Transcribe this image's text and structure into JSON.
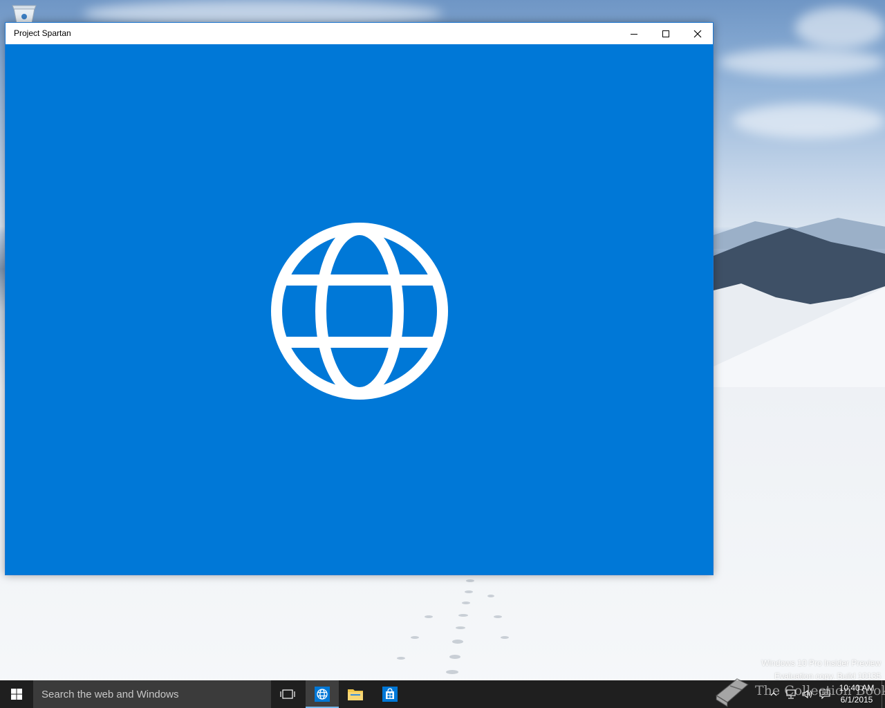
{
  "desktop": {
    "icon_names": {
      "recycle_bin": "recycle-bin-icon"
    },
    "watermark": {
      "line1": "Windows 10 Pro Insider Preview",
      "line2": "Evaluation copy. Build 10135"
    },
    "overlay_logo": {
      "text": "The Collection Book",
      "icon": "book-icon"
    }
  },
  "window": {
    "title": "Project Spartan",
    "buttons": {
      "minimize": "minimize-icon",
      "maximize": "maximize-icon",
      "close": "close-icon"
    },
    "splash": {
      "icon": "globe-icon",
      "background_color": "#0078d7"
    }
  },
  "taskbar": {
    "start_icon": "windows-logo-icon",
    "search": {
      "placeholder": "Search the web and Windows"
    },
    "task_view_icon": "task-view-icon",
    "apps": [
      {
        "name": "Project Spartan",
        "icon": "globe-icon",
        "active": true
      },
      {
        "name": "File Explorer",
        "icon": "folder-icon",
        "active": false
      },
      {
        "name": "Store",
        "icon": "store-icon",
        "active": false
      }
    ],
    "tray": {
      "icons": [
        "chevron-up-icon",
        "network-icon",
        "volume-icon",
        "action-center-icon"
      ],
      "time": "10:40 AM",
      "date": "6/1/2015"
    },
    "accent_color": "#76b9ed"
  }
}
